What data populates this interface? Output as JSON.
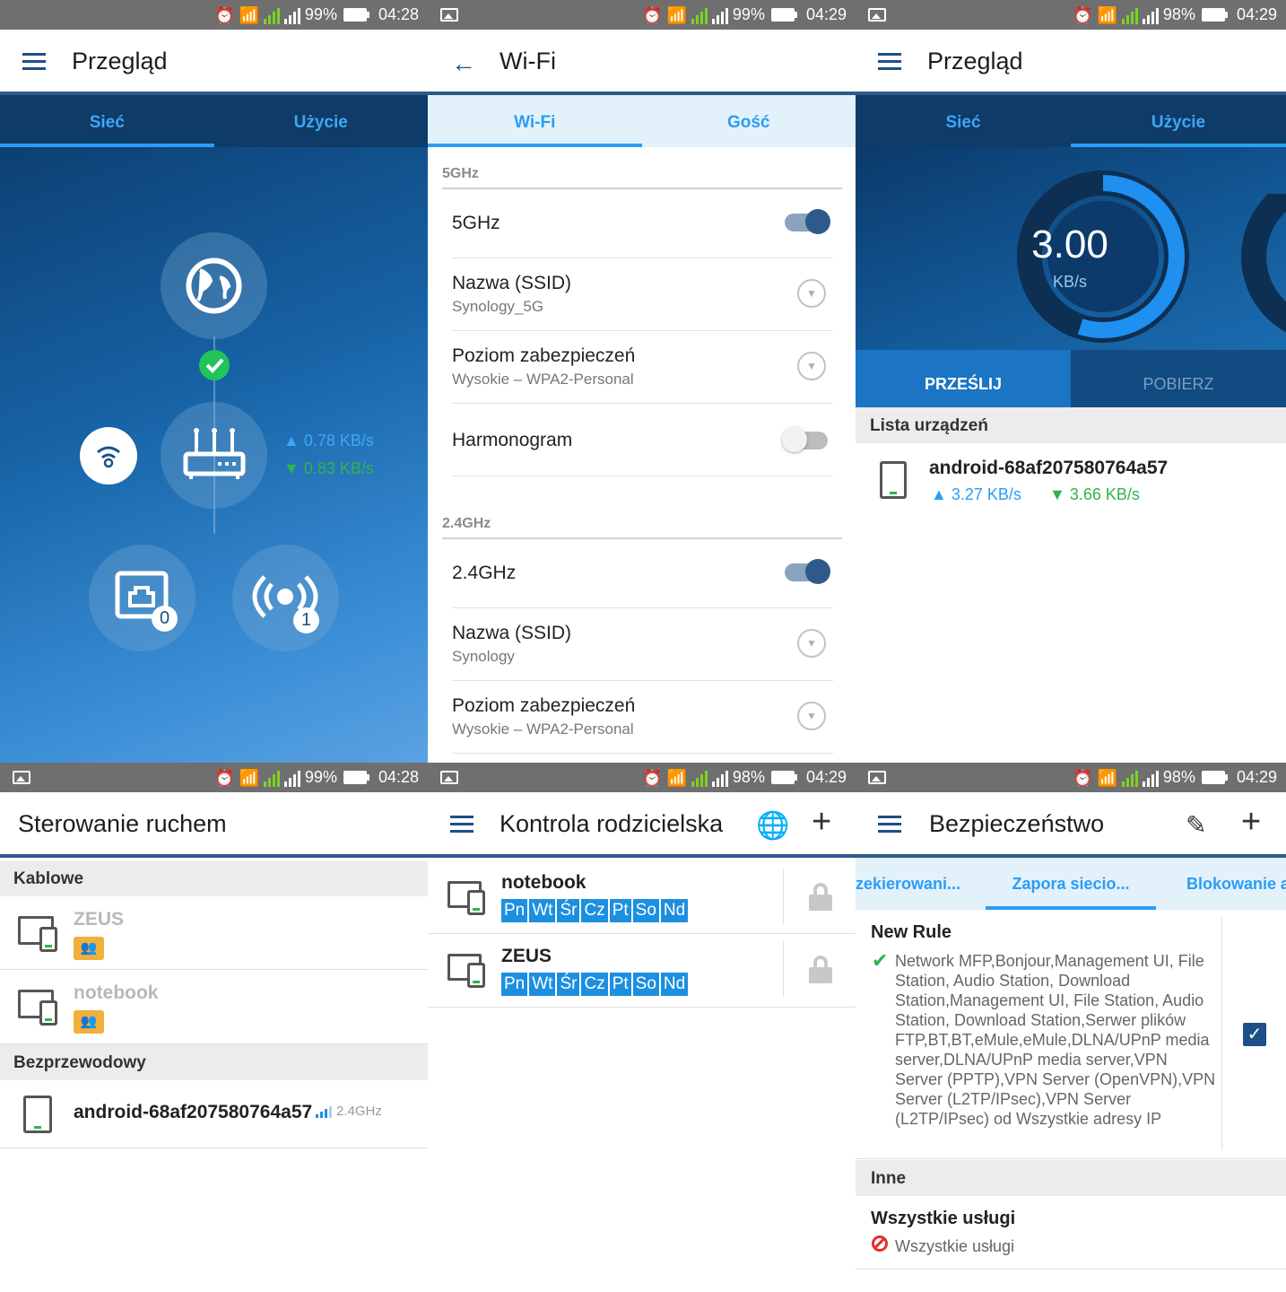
{
  "status": [
    {
      "battery": "99%",
      "time": "04:28",
      "photo_icon": false
    },
    {
      "battery": "99%",
      "time": "04:29",
      "photo_icon": true
    },
    {
      "battery": "98%",
      "time": "04:29",
      "photo_icon": true
    },
    {
      "battery": "99%",
      "time": "04:28",
      "photo_icon": true
    },
    {
      "battery": "98%",
      "time": "04:29",
      "photo_icon": true
    },
    {
      "battery": "98%",
      "time": "04:29",
      "photo_icon": true
    }
  ],
  "overview": {
    "title": "Przegląd",
    "tabs": [
      "Sieć",
      "Użycie"
    ],
    "upload_rate": "0.78 KB/s",
    "download_rate": "0.83 KB/s",
    "wired_count": "0",
    "wireless_count": "1"
  },
  "wifi": {
    "title": "Wi-Fi",
    "tabs": [
      "Wi-Fi",
      "Gość"
    ],
    "band5": {
      "section": "5GHz",
      "toggle_label": "5GHz",
      "toggle_on": true,
      "ssid_label": "Nazwa (SSID)",
      "ssid_value": "Synology_5G",
      "security_label": "Poziom zabezpieczeń",
      "security_value": "Wysokie – WPA2-Personal",
      "schedule_label": "Harmonogram",
      "schedule_on": false
    },
    "band24": {
      "section": "2.4GHz",
      "toggle_label": "2.4GHz",
      "toggle_on": true,
      "ssid_label": "Nazwa (SSID)",
      "ssid_value": "Synology",
      "security_label": "Poziom zabezpieczeń",
      "security_value": "Wysokie – WPA2-Personal"
    }
  },
  "usage": {
    "title": "Przegląd",
    "tabs": [
      "Sieć",
      "Użycie"
    ],
    "gauge_value": "3.00",
    "gauge_unit": "KB/s",
    "gauge_fraction": 0.55,
    "upload_tab": "PRZEŚLIJ",
    "download_tab": "POBIERZ",
    "device_list_header": "Lista urządzeń",
    "device": {
      "name": "android-68af207580764a57",
      "up": "3.27 KB/s",
      "down": "3.66 KB/s"
    }
  },
  "traffic": {
    "title": "Sterowanie ruchem",
    "wired_header": "Kablowe",
    "wired": [
      {
        "name": "ZEUS"
      },
      {
        "name": "notebook"
      }
    ],
    "wireless_header": "Bezprzewodowy",
    "wireless": [
      {
        "name": "android-68af207580764a57",
        "band": "2.4GHz"
      }
    ]
  },
  "parental": {
    "title": "Kontrola rodzicielska",
    "devices": [
      {
        "name": "notebook",
        "days": [
          "Pn",
          "Wt",
          "Śr",
          "Cz",
          "Pt",
          "So",
          "Nd"
        ]
      },
      {
        "name": "ZEUS",
        "days": [
          "Pn",
          "Wt",
          "Śr",
          "Cz",
          "Pt",
          "So",
          "Nd"
        ]
      }
    ]
  },
  "security": {
    "title": "Bezpieczeństwo",
    "tabs": [
      "zekierowani...",
      "Zapora siecio...",
      "Blokowanie a"
    ],
    "rule_title": "New Rule",
    "rule_text": "Network MFP,Bonjour,Management UI, File Station, Audio Station, Download Station,Management UI, File Station, Audio Station, Download Station,Serwer plików FTP,BT,BT,eMule,eMule,DLNA/UPnP media server,DLNA/UPnP media server,VPN Server (PPTP),VPN Server (OpenVPN),VPN Server (L2TP/IPsec),VPN Server (L2TP/IPsec) od Wszystkie adresy IP",
    "rule_checked": true,
    "other_header": "Inne",
    "all_services_title": "Wszystkie usługi",
    "all_services_text": "Wszystkie usługi"
  },
  "colors": {
    "accent": "#2a9df4",
    "brand": "#2d5a8a",
    "up": "#2a9df4",
    "down": "#2fb44b",
    "orange": "#f0b03c"
  }
}
